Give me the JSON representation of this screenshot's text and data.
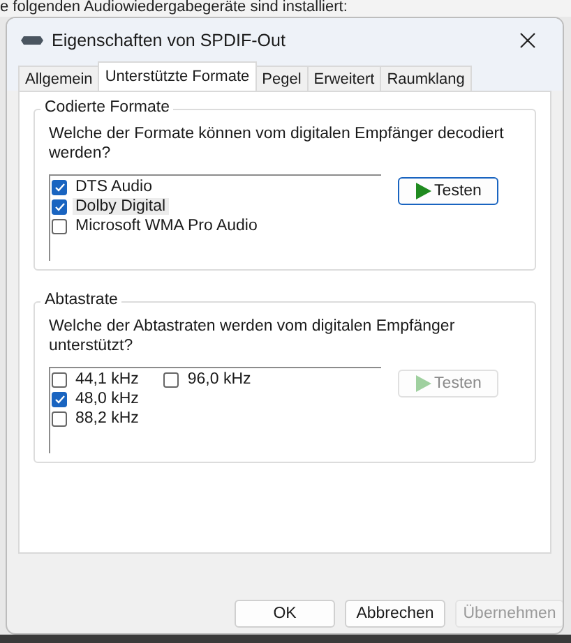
{
  "background_text": "e folgenden Audiowiedergabegeräte sind installiert:",
  "window": {
    "title": "Eigenschaften von SPDIF-Out"
  },
  "tabs": [
    {
      "label": "Allgemein",
      "selected": false
    },
    {
      "label": "Unterstützte Formate",
      "selected": true
    },
    {
      "label": "Pegel",
      "selected": false
    },
    {
      "label": "Erweitert",
      "selected": false
    },
    {
      "label": "Raumklang",
      "selected": false
    }
  ],
  "groups": [
    {
      "title": "Codierte Formate",
      "prompt": "Welche der Formate können vom digitalen Empfänger decodiert werden?",
      "items": [
        {
          "label": "DTS Audio",
          "checked": true,
          "selected": false
        },
        {
          "label": "Dolby Digital",
          "checked": true,
          "selected": true
        },
        {
          "label": "Microsoft WMA Pro Audio",
          "checked": false,
          "selected": false
        }
      ],
      "test_button": {
        "label": "Testen",
        "disabled": false
      }
    },
    {
      "title": "Abtastrate",
      "prompt": "Welche der Abtastraten werden vom digitalen Empfänger unterstützt?",
      "items": [
        {
          "label": "44,1 kHz",
          "checked": false,
          "selected": false
        },
        {
          "label": "48,0 kHz",
          "checked": true,
          "selected": false
        },
        {
          "label": "88,2 kHz",
          "checked": false,
          "selected": false
        },
        {
          "label": "96,0 kHz",
          "checked": false,
          "selected": false
        }
      ],
      "test_button": {
        "label": "Testen",
        "disabled": true
      }
    }
  ],
  "buttons": [
    {
      "label": "OK",
      "disabled": false
    },
    {
      "label": "Abbrechen",
      "disabled": false
    },
    {
      "label": "Übernehmen",
      "disabled": true
    }
  ]
}
